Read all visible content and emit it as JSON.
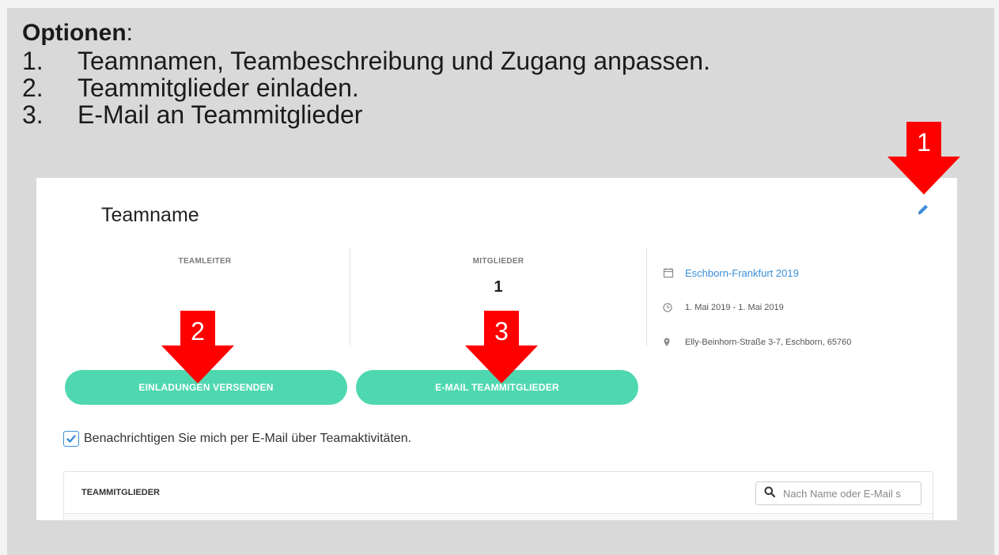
{
  "instructions": {
    "title": "Optionen",
    "title_suffix": ":",
    "items": [
      {
        "num": "1.",
        "text": "Teamnamen, Teambeschreibung und Zugang anpassen."
      },
      {
        "num": "2.",
        "text": "Teammitglieder einladen."
      },
      {
        "num": "3.",
        "text": "E-Mail an Teammitglieder"
      }
    ]
  },
  "team": {
    "name": "Teamname",
    "leader_label": "TEAMLEITER",
    "members_label": "MITGLIEDER",
    "members_count": "1"
  },
  "event": {
    "name": "Eschborn-Frankfurt 2019",
    "date": "1. Mai 2019 - 1. Mai 2019",
    "address": "Elly-Beinhorn-Straße 3-7, Eschborn, 65760"
  },
  "actions": {
    "invite_label": "EINLADUNGEN VERSENDEN",
    "email_label": "E-MAIL TEAMMITGLIEDER"
  },
  "notify": {
    "label": "Benachrichtigen Sie mich per E-Mail über Teamaktivitäten.",
    "checked": true
  },
  "members_table": {
    "title": "TEAMMITGLIEDER",
    "search_placeholder": "Nach Name oder E-Mail s"
  },
  "annotations": {
    "arrow1": "1",
    "arrow2": "2",
    "arrow3": "3"
  },
  "colors": {
    "accent_button": "#4fd8b0",
    "link": "#3a8fd9",
    "arrow": "#ff0000"
  },
  "icons": {
    "edit": "pencil-icon",
    "event": "calendar-icon",
    "date": "clock-icon",
    "address": "map-pin-icon",
    "search": "search-icon",
    "checkbox": "checkmark-icon"
  }
}
